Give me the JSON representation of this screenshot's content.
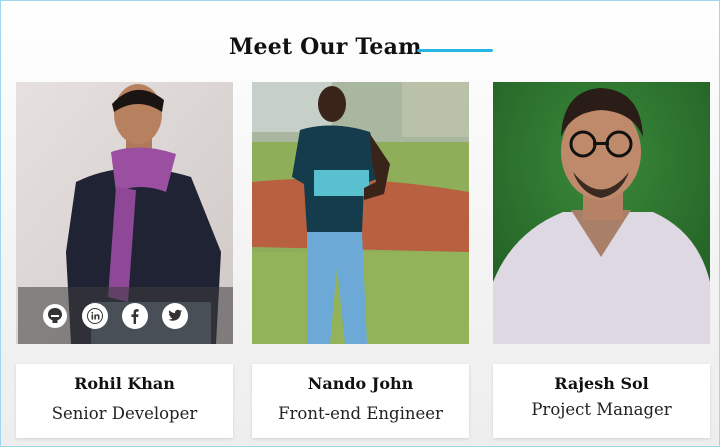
{
  "section": {
    "title": "Meet Our Team",
    "accent": "#27b5e6"
  },
  "members": [
    {
      "name": "Rohil Khan",
      "role": "Senior Developer"
    },
    {
      "name": "Nando John",
      "role": "Front-end Engineer"
    },
    {
      "name": "Rajesh Sol",
      "role": "Project Manager"
    }
  ],
  "social_icons": [
    "github-icon",
    "linkedin-icon",
    "facebook-icon",
    "twitter-icon"
  ]
}
